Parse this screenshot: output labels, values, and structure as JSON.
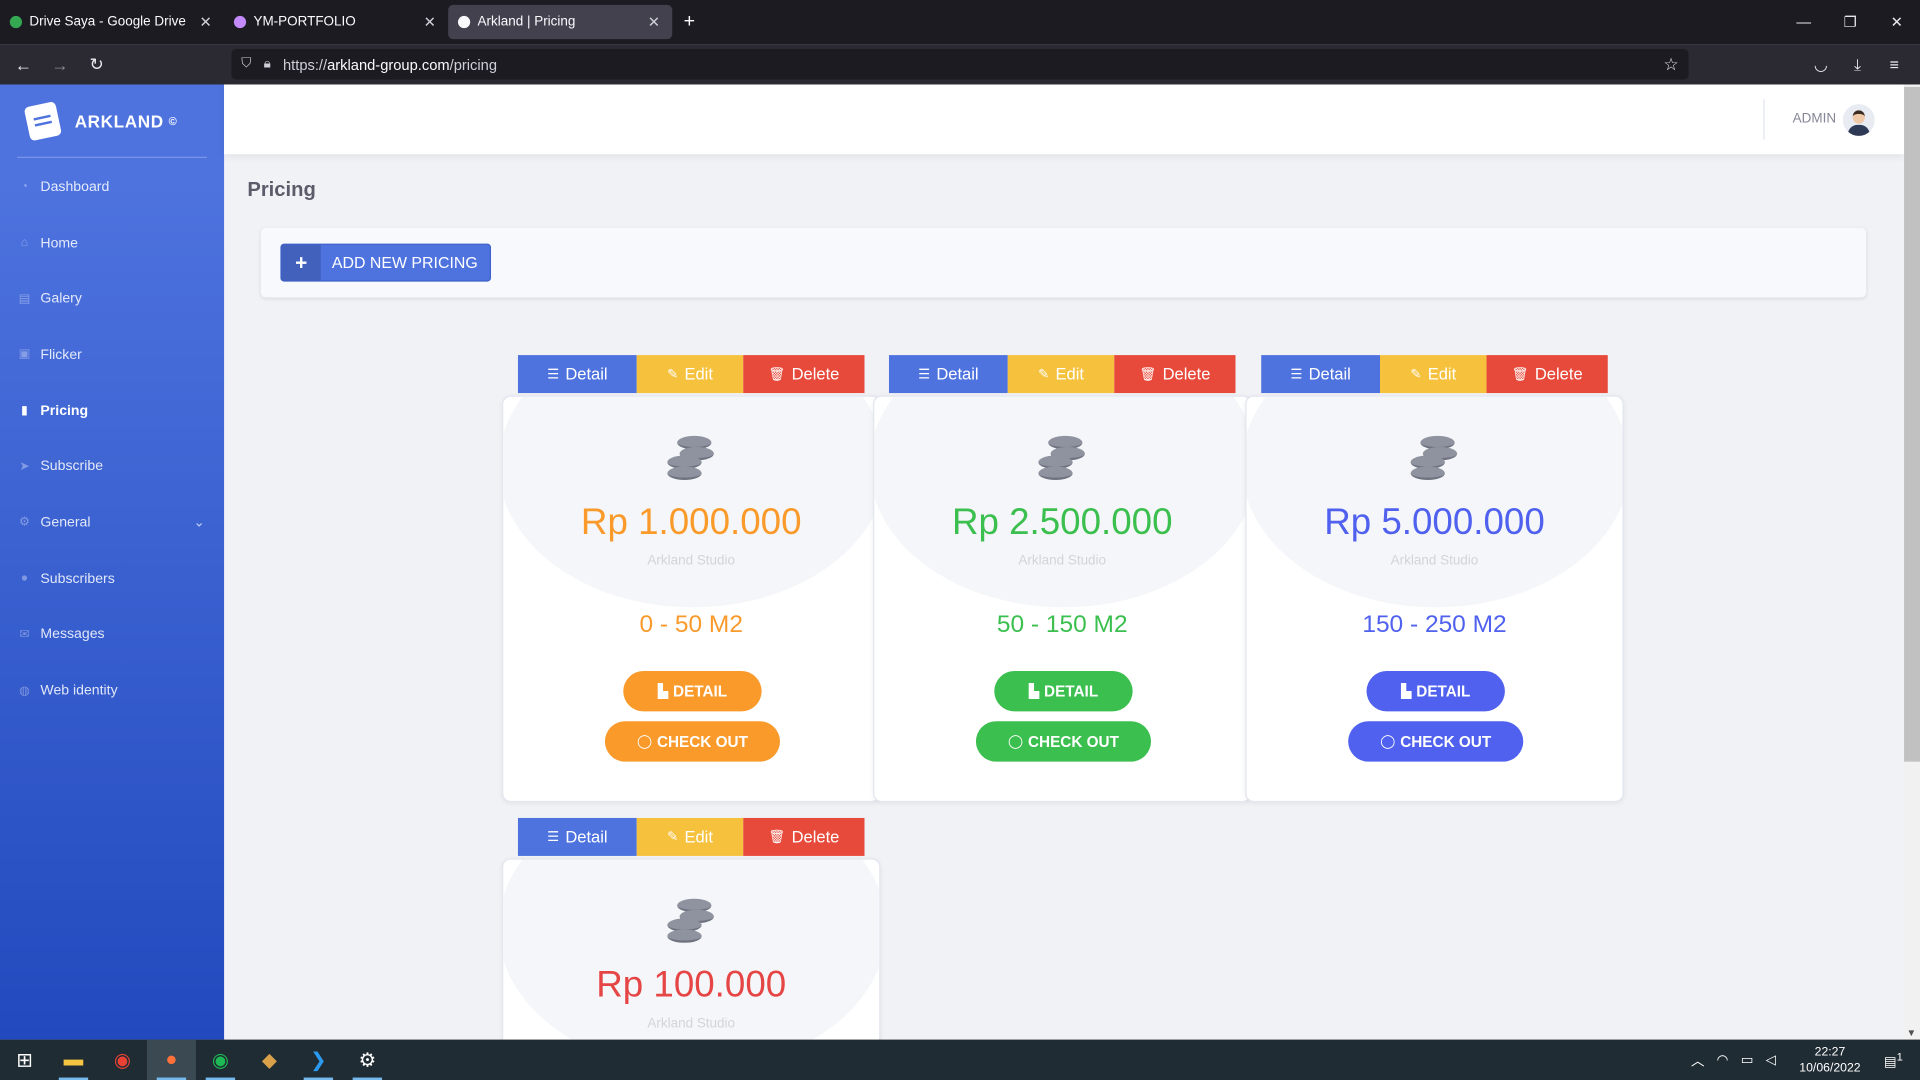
{
  "browser": {
    "tabs": [
      {
        "label": "Drive Saya - Google Drive",
        "color": "#34a853"
      },
      {
        "label": "YM-PORTFOLIO",
        "color": "#c58af9"
      },
      {
        "label": "Arkland | Pricing",
        "color": "#fbfbfe"
      }
    ],
    "url_prefix": "https://",
    "url_host": "arkland-group.com",
    "url_path": "/pricing"
  },
  "sidebar": {
    "brand": "ARKLAND",
    "brand_mark": "©",
    "items": [
      {
        "label": "Dashboard",
        "icon": "tachometer-icon"
      },
      {
        "label": "Home",
        "icon": "home-icon"
      },
      {
        "label": "Galery",
        "icon": "images-icon"
      },
      {
        "label": "Flicker",
        "icon": "image-icon"
      },
      {
        "label": "Pricing",
        "icon": "clipboard-icon",
        "active": true
      },
      {
        "label": "Subscribe",
        "icon": "paper-plane-icon"
      },
      {
        "label": "General",
        "icon": "cogs-icon",
        "has_submenu": true
      },
      {
        "label": "Subscribers",
        "icon": "user-icon"
      },
      {
        "label": "Messages",
        "icon": "envelope-icon"
      },
      {
        "label": "Web identity",
        "icon": "globe-icon"
      }
    ]
  },
  "topbar": {
    "user": "ADMIN"
  },
  "page": {
    "title": "Pricing",
    "add_button": "ADD NEW PRICING"
  },
  "actions": {
    "detail": "Detail",
    "edit": "Edit",
    "delete": "Delete"
  },
  "cards": [
    {
      "price": "Rp 1.000.000",
      "studio": "Arkland Studio",
      "range": "0 - 50 M2",
      "detail": "DETAIL",
      "checkout": "CHECK OUT",
      "color": "#f99a2b"
    },
    {
      "price": "Rp 2.500.000",
      "studio": "Arkland Studio",
      "range": "50 - 150 M2",
      "detail": "DETAIL",
      "checkout": "CHECK OUT",
      "color": "#3bbf4e"
    },
    {
      "price": "Rp 5.000.000",
      "studio": "Arkland Studio",
      "range": "150 - 250 M2",
      "detail": "DETAIL",
      "checkout": "CHECK OUT",
      "color": "#4f61ee"
    },
    {
      "price": "Rp 100.000",
      "studio": "Arkland Studio",
      "color": "#e64545"
    }
  ],
  "taskbar": {
    "time": "22:27",
    "date": "10/06/2022",
    "notifications": "1"
  },
  "colors": {
    "primary": "#4e73df",
    "warning": "#f6c23e",
    "danger": "#e74a3b"
  }
}
